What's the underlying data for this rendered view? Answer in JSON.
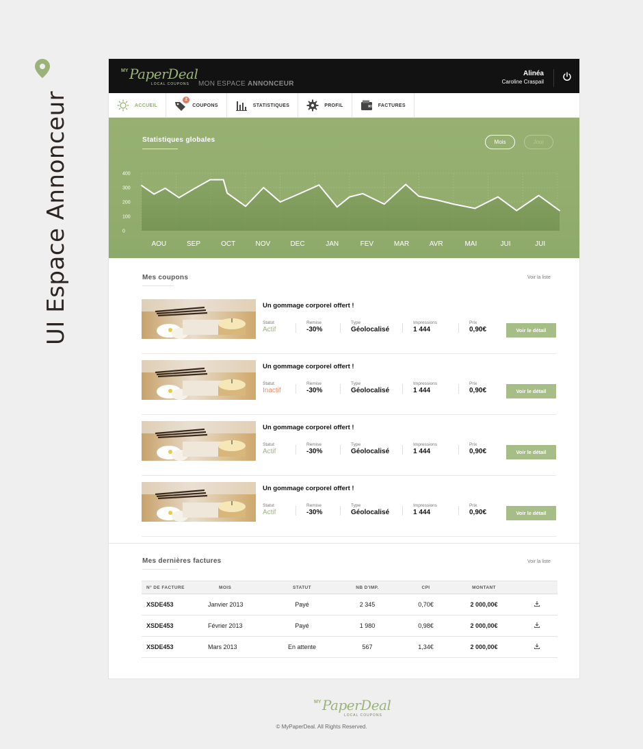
{
  "side_label": "UI Espace Annonceur",
  "header": {
    "logo_my": "MY",
    "logo_name": "PaperDeal",
    "logo_tagline": "LOCAL COUPONS",
    "title_prefix": "MON ESPACE",
    "title_bold": "ANNONCEUR",
    "user_name": "Alinéa",
    "user_fullname": "Caroline Craspail"
  },
  "nav": {
    "items": [
      {
        "label": "ACCUEIL",
        "icon": "sun-icon",
        "active": true
      },
      {
        "label": "COUPONS",
        "icon": "tag-icon",
        "badge": "2"
      },
      {
        "label": "STATISTIQUES",
        "icon": "bar-chart-icon"
      },
      {
        "label": "PROFIL",
        "icon": "gear-icon"
      },
      {
        "label": "FACTURES",
        "icon": "wallet-icon"
      }
    ]
  },
  "stats": {
    "title": "Statistiques globales",
    "toggle_month": "Mois",
    "toggle_day": "Jour"
  },
  "chart_data": {
    "type": "area",
    "title": "Statistiques globales",
    "categories": [
      "AOU",
      "SEP",
      "OCT",
      "NOV",
      "DEC",
      "JAN",
      "FEV",
      "MAR",
      "AVR",
      "MAI",
      "JUI",
      "JUI"
    ],
    "y_ticks": [
      0,
      100,
      200,
      300,
      400
    ],
    "ylim": [
      0,
      400
    ],
    "grid": true,
    "line_color": "#ffffff",
    "series": [
      {
        "x": [
          0,
          0.36,
          0.68,
          1.08,
          1.5,
          1.98,
          2.36,
          2.47,
          3.0,
          3.52,
          4.0,
          4.53,
          5.12,
          5.64,
          6.0,
          6.38,
          7.0,
          7.62,
          8.0,
          8.5,
          9.0,
          9.62,
          10.28,
          10.82,
          11.46,
          12.06
        ],
        "y": [
          315,
          255,
          295,
          230,
          290,
          355,
          355,
          262,
          170,
          300,
          200,
          255,
          318,
          165,
          235,
          258,
          185,
          322,
          240,
          215,
          185,
          155,
          235,
          140,
          245,
          140
        ]
      }
    ]
  },
  "coupons": {
    "title": "Mes coupons",
    "view_all": "Voir la liste",
    "labels": {
      "status": "Statut",
      "discount": "Remise",
      "type": "Type",
      "impressions": "Impressions",
      "price": "Prix"
    },
    "detail_button": "Voir le détail",
    "items": [
      {
        "title": "Un gommage corporel offert !",
        "status": "Actif",
        "status_kind": "active",
        "discount": "-30%",
        "type": "Géolocalisé",
        "impressions": "1 444",
        "price": "0,90€"
      },
      {
        "title": "Un gommage corporel offert !",
        "status": "Inactif",
        "status_kind": "inactive",
        "discount": "-30%",
        "type": "Géolocalisé",
        "impressions": "1 444",
        "price": "0,90€"
      },
      {
        "title": "Un gommage corporel offert !",
        "status": "Actif",
        "status_kind": "active",
        "discount": "-30%",
        "type": "Géolocalisé",
        "impressions": "1 444",
        "price": "0,90€"
      },
      {
        "title": "Un gommage corporel offert !",
        "status": "Actif",
        "status_kind": "active",
        "discount": "-30%",
        "type": "Géolocalisé",
        "impressions": "1 444",
        "price": "0,90€"
      }
    ]
  },
  "invoices": {
    "title": "Mes dernières factures",
    "view_all": "Voir la liste",
    "columns": [
      "N° DE FACTURE",
      "MOIS",
      "STATUT",
      "NB D'IMP.",
      "CPI",
      "MONTANT"
    ],
    "rows": [
      {
        "number": "XSDE453",
        "month": "Janvier 2013",
        "status": "Payé",
        "status_kind": "paid",
        "impressions": "2 345",
        "cpi": "0,70€",
        "amount": "2 000,00€"
      },
      {
        "number": "XSDE453",
        "month": "Février 2013",
        "status": "Payé",
        "status_kind": "paid",
        "impressions": "1 980",
        "cpi": "0,98€",
        "amount": "2 000,00€"
      },
      {
        "number": "XSDE453",
        "month": "Mars 2013",
        "status": "En attente",
        "status_kind": "pending",
        "impressions": "567",
        "cpi": "1,34€",
        "amount": "2 000,00€"
      }
    ]
  },
  "footer": {
    "logo_my": "MY",
    "logo_name": "PaperDeal",
    "logo_tagline": "LOCAL COUPONS",
    "copyright": "© MyPaperDeal. All Rights Reserved."
  },
  "colors": {
    "accent_green": "#98b173",
    "button_green": "#a7bd87",
    "status_green": "#9bb57a",
    "status_orange": "#e98a5f",
    "header_black": "#121212"
  }
}
